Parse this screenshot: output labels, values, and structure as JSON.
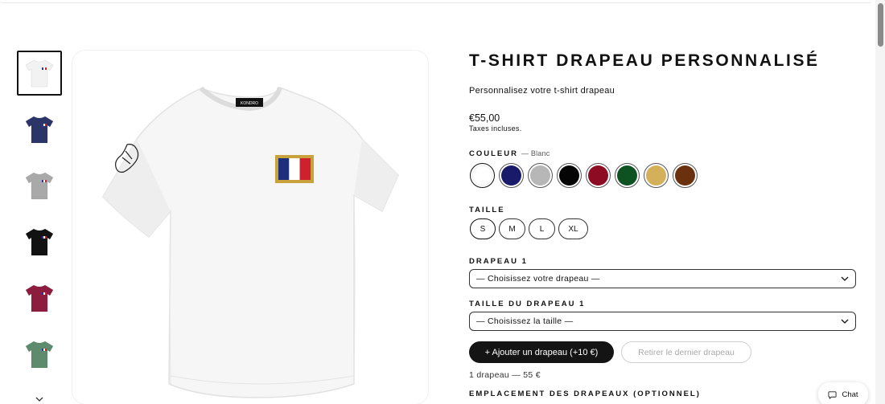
{
  "product": {
    "title": "T-SHIRT DRAPEAU PERSONNALISÉ",
    "subtitle": "Personnalisez votre t-shirt drapeau",
    "price": "€55,00",
    "tax_note": "Taxes incluses."
  },
  "tshirt_label": "KONDRO",
  "color_option": {
    "label": "COULEUR",
    "selected": "— Blanc",
    "swatches": [
      {
        "name": "Blanc",
        "color": "#ffffff"
      },
      {
        "name": "Marine",
        "color": "#1a1a6b"
      },
      {
        "name": "Gris",
        "color": "#b7b7b7"
      },
      {
        "name": "Noir",
        "color": "#050505"
      },
      {
        "name": "Bordeaux",
        "color": "#8e0b24"
      },
      {
        "name": "Vert",
        "color": "#0f5222"
      },
      {
        "name": "Sable",
        "color": "#d5b05b"
      },
      {
        "name": "Marron",
        "color": "#6b310f"
      }
    ]
  },
  "size_option": {
    "label": "TAILLE",
    "sizes": [
      "S",
      "M",
      "L",
      "XL"
    ],
    "selected": "S"
  },
  "flag1": {
    "label": "DRAPEAU 1",
    "value": "— Choisissez votre drapeau —"
  },
  "flag1_size": {
    "label": "TAILLE DU DRAPEAU 1",
    "value": "— Choisissez la taille —"
  },
  "buttons": {
    "add_flag": "+ Ajouter un drapeau (+10 €)",
    "remove_flag": "Retirer le dernier drapeau"
  },
  "summary": "1 drapeau — 55 €",
  "placement_label": "EMPLACEMENT DES DRAPEAUX (OPTIONNEL)",
  "chat_label": "Chat",
  "thumbnails": [
    {
      "color": "#f2f2f2",
      "name": "white"
    },
    {
      "color": "#2c3568",
      "name": "navy"
    },
    {
      "color": "#a9a9a9",
      "name": "grey"
    },
    {
      "color": "#121212",
      "name": "black"
    },
    {
      "color": "#8c1d3f",
      "name": "burgundy"
    },
    {
      "color": "#5e8b6e",
      "name": "green"
    }
  ]
}
